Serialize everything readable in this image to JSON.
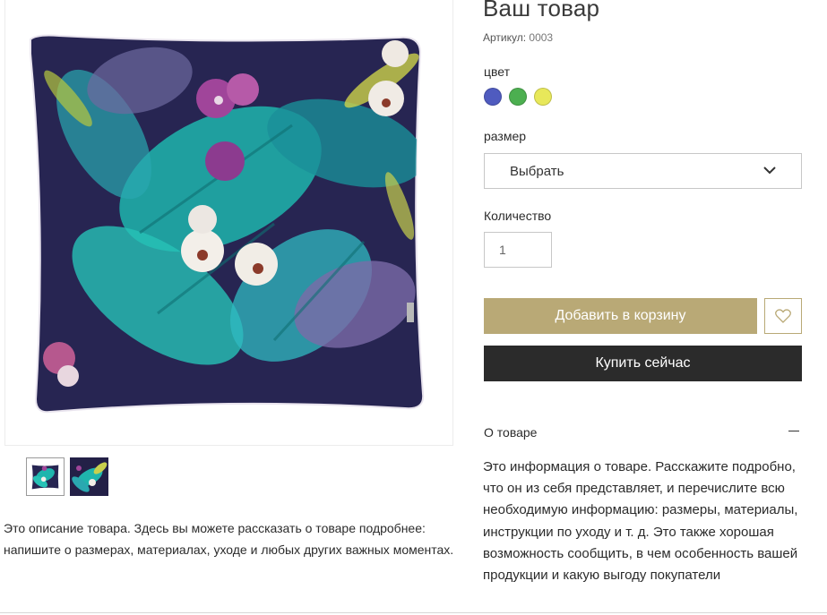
{
  "product": {
    "title": "Ваш товар",
    "sku_label": "Артикул: ",
    "sku_value": "0003",
    "description": "Это описание товара. Здесь вы можете рассказать о товаре подробнее: напишите о размерах, материалах, уходе и любых других важных моментах."
  },
  "gallery": {
    "thumbnails": [
      "pillow-front",
      "pillow-pattern"
    ],
    "selected": 0
  },
  "options": {
    "color_label": "цвет",
    "colors": [
      "#4f5bbf",
      "#4caf50",
      "#e8e85a"
    ],
    "size_label": "размер",
    "size_value": "Выбрать",
    "quantity_label": "Количество",
    "quantity_value": "1"
  },
  "actions": {
    "add_to_cart": "Добавить в корзину",
    "buy_now": "Купить сейчас",
    "wishlist_icon": "heart-icon"
  },
  "accordion": {
    "title": "О товаре",
    "toggle_icon": "minus-icon",
    "content": "Это информация о товаре. Расскажите подробно, что он из себя представляет, и перечислите всю необходимую информацию: размеры, материалы, инструкции по уходу и т. д. Это также хорошая возможность сообщить, в чем особенность вашей продукции и какую выгоду покупатели"
  },
  "colors": {
    "accent": "#b9a976",
    "dark_button": "#2b2b2b"
  }
}
